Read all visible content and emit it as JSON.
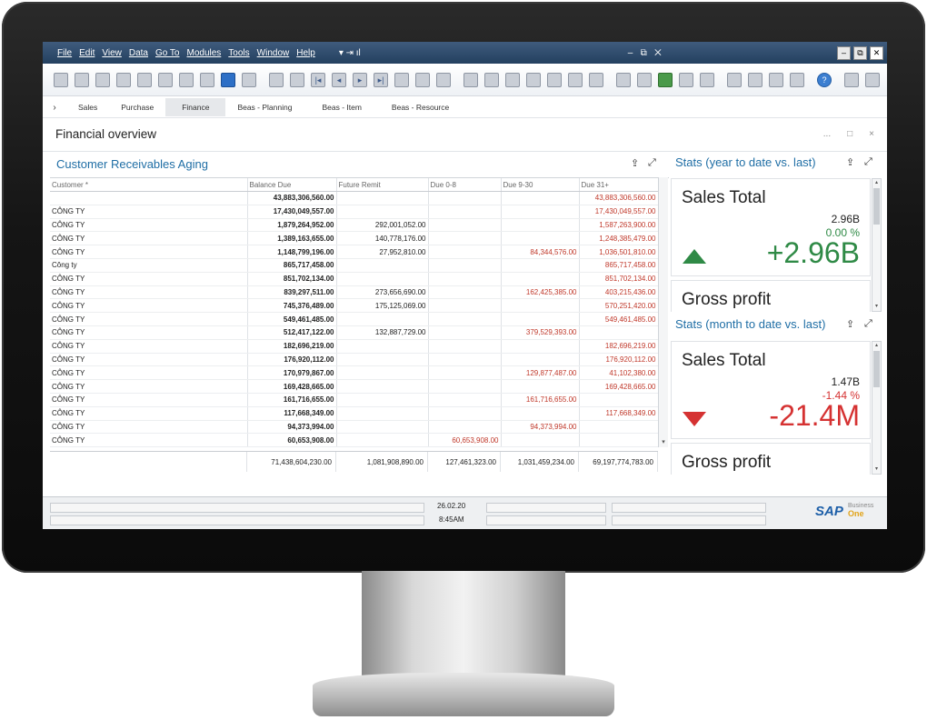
{
  "menu": [
    "File",
    "Edit",
    "View",
    "Data",
    "Go To",
    "Modules",
    "Tools",
    "Window",
    "Help"
  ],
  "nav_tabs": [
    {
      "label": "Sales"
    },
    {
      "label": "Purchase"
    },
    {
      "label": "Finance"
    },
    {
      "label": "Beas - Planning"
    },
    {
      "label": "Beas - Item"
    },
    {
      "label": "Beas - Resource"
    }
  ],
  "page": {
    "title": "Financial overview",
    "controls": [
      "...",
      "□",
      "×"
    ]
  },
  "aging": {
    "title": "Customer Receivables Aging",
    "columns": [
      "Customer *",
      "Balance Due",
      "Future Remit",
      "Due 0-8",
      "Due 9-30",
      "Due 31+"
    ],
    "rows": [
      {
        "customer": "",
        "balance": "43,883,306,560.00",
        "future": "",
        "d08": "",
        "d930": "",
        "d31": "43,883,306,560.00"
      },
      {
        "customer": "CÔNG TY",
        "balance": "17,430,049,557.00",
        "future": "",
        "d08": "",
        "d930": "",
        "d31": "17,430,049,557.00"
      },
      {
        "customer": "CÔNG TY",
        "balance": "1,879,264,952.00",
        "future": "292,001,052.00",
        "d08": "",
        "d930": "",
        "d31": "1,587,263,900.00"
      },
      {
        "customer": "CÔNG TY",
        "balance": "1,389,163,655.00",
        "future": "140,778,176.00",
        "d08": "",
        "d930": "",
        "d31": "1,248,385,479.00"
      },
      {
        "customer": "CÔNG TY",
        "balance": "1,148,799,196.00",
        "future": "27,952,810.00",
        "d08": "",
        "d930": "84,344,576.00",
        "d31": "1,036,501,810.00"
      },
      {
        "customer": "Công ty",
        "balance": "865,717,458.00",
        "future": "",
        "d08": "",
        "d930": "",
        "d31": "865,717,458.00"
      },
      {
        "customer": "CÔNG TY",
        "balance": "851,702,134.00",
        "future": "",
        "d08": "",
        "d930": "",
        "d31": "851,702,134.00"
      },
      {
        "customer": "CÔNG TY",
        "balance": "839,297,511.00",
        "future": "273,656,690.00",
        "d08": "",
        "d930": "162,425,385.00",
        "d31": "403,215,436.00"
      },
      {
        "customer": "CÔNG TY",
        "balance": "745,376,489.00",
        "future": "175,125,069.00",
        "d08": "",
        "d930": "",
        "d31": "570,251,420.00"
      },
      {
        "customer": "CÔNG TY",
        "balance": "549,461,485.00",
        "future": "",
        "d08": "",
        "d930": "",
        "d31": "549,461,485.00"
      },
      {
        "customer": "CÔNG TY",
        "balance": "512,417,122.00",
        "future": "132,887,729.00",
        "d08": "",
        "d930": "379,529,393.00",
        "d31": ""
      },
      {
        "customer": "CÔNG TY",
        "balance": "182,696,219.00",
        "future": "",
        "d08": "",
        "d930": "",
        "d31": "182,696,219.00"
      },
      {
        "customer": "CÔNG TY",
        "balance": "176,920,112.00",
        "future": "",
        "d08": "",
        "d930": "",
        "d31": "176,920,112.00"
      },
      {
        "customer": "CÔNG TY",
        "balance": "170,979,867.00",
        "future": "",
        "d08": "",
        "d930": "129,877,487.00",
        "d31": "41,102,380.00"
      },
      {
        "customer": "CÔNG TY",
        "balance": "169,428,665.00",
        "future": "",
        "d08": "",
        "d930": "",
        "d31": "169,428,665.00"
      },
      {
        "customer": "CÔNG TY",
        "balance": "161,716,655.00",
        "future": "",
        "d08": "",
        "d930": "161,716,655.00",
        "d31": ""
      },
      {
        "customer": "CÔNG TY",
        "balance": "117,668,349.00",
        "future": "",
        "d08": "",
        "d930": "",
        "d31": "117,668,349.00"
      },
      {
        "customer": "CÔNG TY",
        "balance": "94,373,994.00",
        "future": "",
        "d08": "",
        "d930": "94,373,994.00",
        "d31": ""
      },
      {
        "customer": "CÔNG TY",
        "balance": "60,653,908.00",
        "future": "",
        "d08": "60,653,908.00",
        "d930": "",
        "d31": ""
      }
    ],
    "totals": {
      "balance": "71,438,604,230.00",
      "future": "1,081,908,890.00",
      "d08": "127,461,323.00",
      "d930": "1,031,459,234.00",
      "d31": "69,197,774,783.00"
    }
  },
  "stats_ytd": {
    "title": "Stats (year to date vs. last)",
    "sales": {
      "label": "Sales Total",
      "previous": "2.96B",
      "pct": "0.00 %",
      "value": "+2.96B",
      "trend": "up",
      "color": "#2f8a46"
    },
    "gross": {
      "label": "Gross profit"
    }
  },
  "stats_mtd": {
    "title": "Stats (month to date vs. last)",
    "sales": {
      "label": "Sales Total",
      "previous": "1.47B",
      "pct": "-1.44 %",
      "value": "-21.4M",
      "trend": "down",
      "color": "#d53232"
    },
    "gross": {
      "label": "Gross profit"
    }
  },
  "status": {
    "date": "26.02.20",
    "time": "8:45AM"
  },
  "brand": {
    "name": "SAP",
    "line1": "Business",
    "line2": "One"
  }
}
